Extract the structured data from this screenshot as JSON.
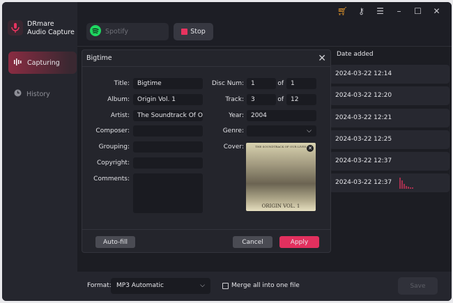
{
  "app": {
    "name_line1": "DRmare",
    "name_line2": "Audio Capture"
  },
  "sidebar": {
    "items": [
      {
        "label": "Capturing",
        "active": true
      },
      {
        "label": "History",
        "active": false
      }
    ]
  },
  "toolbar": {
    "source": "Spotify",
    "stop_label": "Stop"
  },
  "window_controls": [
    "cart-icon",
    "key-icon",
    "menu-icon",
    "minimize-icon",
    "maximize-icon",
    "close-icon"
  ],
  "list": {
    "header": "Date added",
    "rows": [
      "2024-03-22 12:14",
      "2024-03-22 12:20",
      "2024-03-22 12:21",
      "2024-03-22 12:25",
      "2024-03-22 12:37",
      "2024-03-22 12:37"
    ]
  },
  "dialog": {
    "title": "Bigtime",
    "labels": {
      "title": "Title:",
      "album": "Album:",
      "artist": "Artist:",
      "composer": "Composer:",
      "grouping": "Grouping:",
      "copyright": "Copyright:",
      "comments": "Comments:",
      "disc": "Disc Num:",
      "track": "Track:",
      "year": "Year:",
      "genre": "Genre:",
      "cover": "Cover:",
      "of": "of"
    },
    "values": {
      "title": "Bigtime",
      "album": "Origin Vol. 1",
      "artist": "The Soundtrack Of Our Lives",
      "composer": "",
      "grouping": "",
      "copyright": "",
      "comments": "",
      "disc": "1",
      "disc_total": "1",
      "track": "3",
      "track_total": "12",
      "year": "2004",
      "genre": ""
    },
    "cover_text": "ORIGIN VOL. 1",
    "cover_top_text": "THE SOUNDTRACK OF OUR LIVES",
    "buttons": {
      "autofill": "Auto-fill",
      "cancel": "Cancel",
      "apply": "Apply"
    }
  },
  "bottom": {
    "format_label": "Format:",
    "format_value": "MP3 Automatic",
    "merge_label": "Merge all into one file",
    "merge_checked": false,
    "save_label": "Save"
  },
  "colors": {
    "accent": "#e8335f",
    "spotify": "#1ed760",
    "cart": "#e89a2c"
  }
}
